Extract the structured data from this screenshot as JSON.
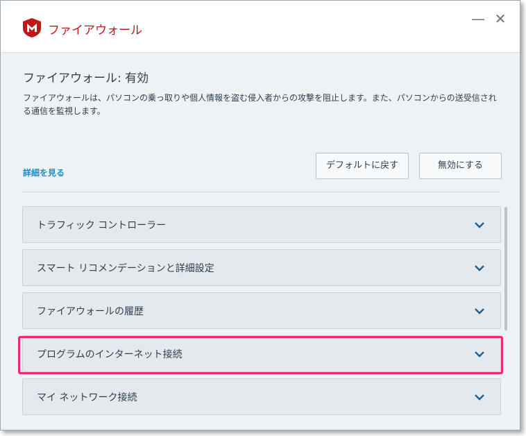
{
  "app": {
    "title": "ファイアウォール"
  },
  "window_controls": {
    "minimize": "—",
    "close": "✕"
  },
  "page": {
    "title": "ファイアウォール: 有効",
    "description": "ファイアウォールは、パソコンの乗っ取りや個人情報を盗む侵入者からの攻撃を阻止します。また、パソコンからの送受信される通信を監視します。",
    "details_link": "詳細を見る"
  },
  "buttons": {
    "restore_default": "デフォルトに戻す",
    "disable": "無効にする"
  },
  "panels": [
    {
      "label": "トラフィック コントローラー"
    },
    {
      "label": "スマート リコメンデーションと詳細設定"
    },
    {
      "label": "ファイアウォールの履歴"
    },
    {
      "label": "プログラムのインターネット接続"
    },
    {
      "label": "マイ ネットワーク接続"
    }
  ],
  "colors": {
    "brand": "#c01818",
    "link": "#1a8fc9",
    "highlight": "#ee2a6d",
    "chevron": "#1d5f94"
  },
  "icons": [
    "mcafee-logo",
    "chevron-down-icon"
  ]
}
